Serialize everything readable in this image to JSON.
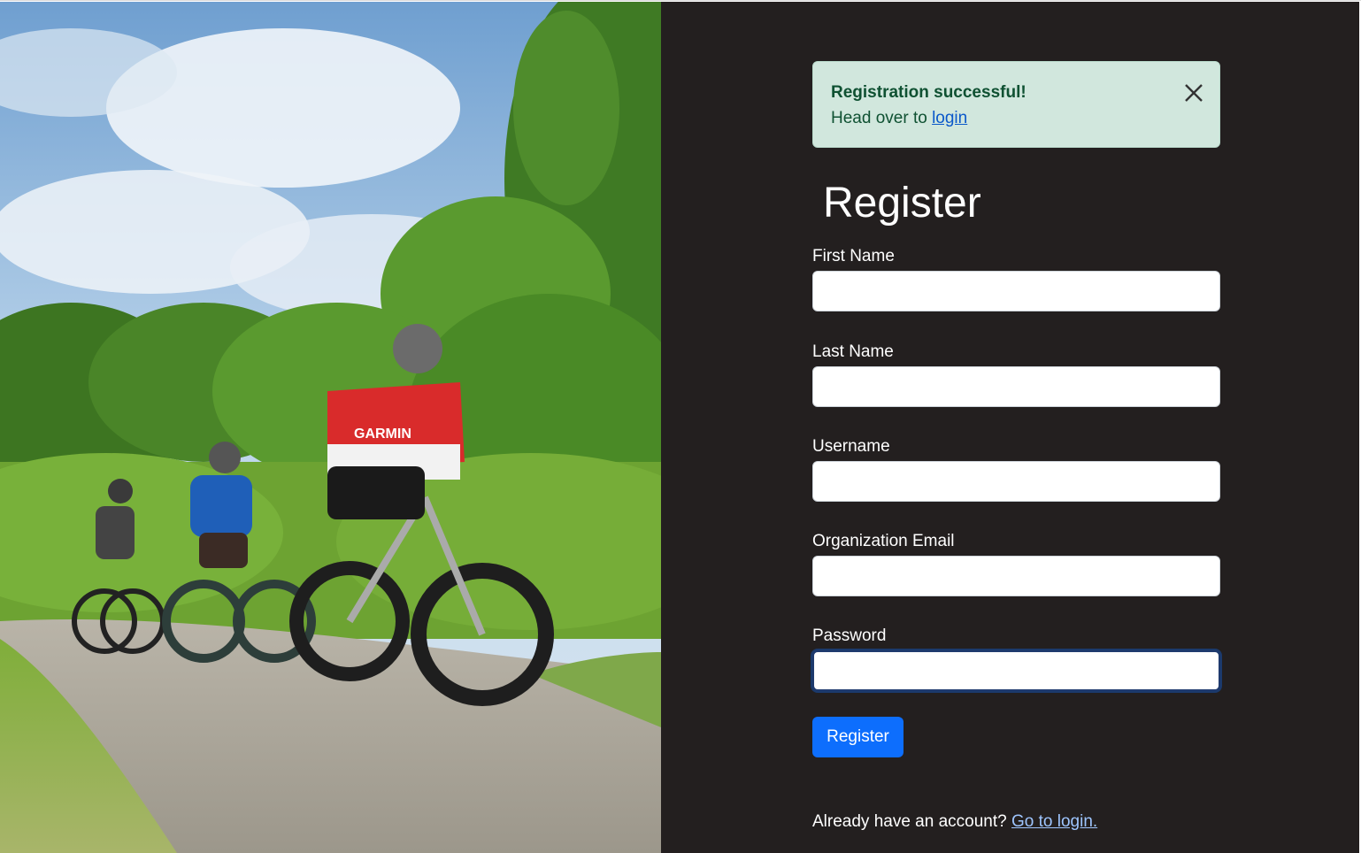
{
  "hero": {
    "image_desc_icon": "photo-icon",
    "jersey_text": "GARMIN"
  },
  "alert": {
    "title": "Registration successful!",
    "body_prefix": "Head over to ",
    "link_label": "login",
    "close_icon": "close-icon"
  },
  "form": {
    "title": "Register",
    "fields": [
      {
        "label": "First Name",
        "value": ""
      },
      {
        "label": "Last Name",
        "value": ""
      },
      {
        "label": "Username",
        "value": ""
      },
      {
        "label": "Organization Email",
        "value": ""
      },
      {
        "label": "Password",
        "value": ""
      }
    ],
    "submit_label": "Register",
    "footer_prefix": "Already have an account? ",
    "footer_link": "Go to login."
  },
  "colors": {
    "panel_bg": "#231f1f",
    "alert_bg": "#d1e7dd",
    "alert_text": "#0f5132",
    "primary": "#0d6efd"
  }
}
